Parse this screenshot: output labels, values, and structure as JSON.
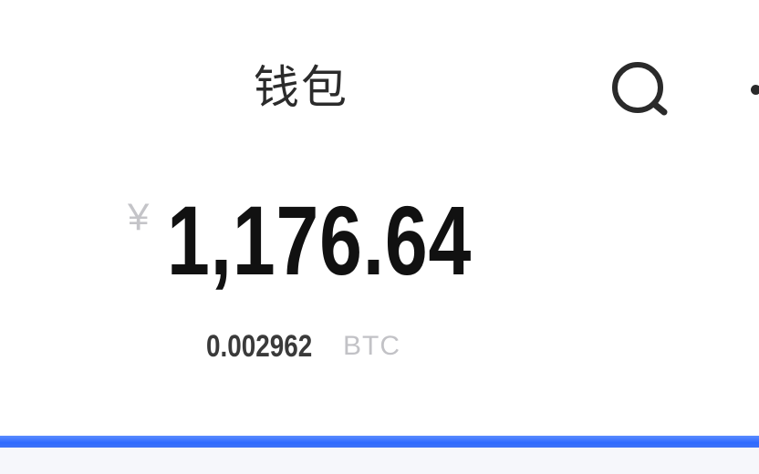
{
  "header": {
    "title": "钱包",
    "search_icon": "search-icon",
    "more_icon": "more-dots-icon"
  },
  "balance": {
    "currency_symbol": "¥",
    "amount": "1,176.64",
    "btc_amount": "0.002962",
    "btc_unit": "BTC"
  },
  "colors": {
    "accent": "#2f6bff",
    "text_primary": "#111111",
    "text_muted": "#c2c2c6"
  }
}
